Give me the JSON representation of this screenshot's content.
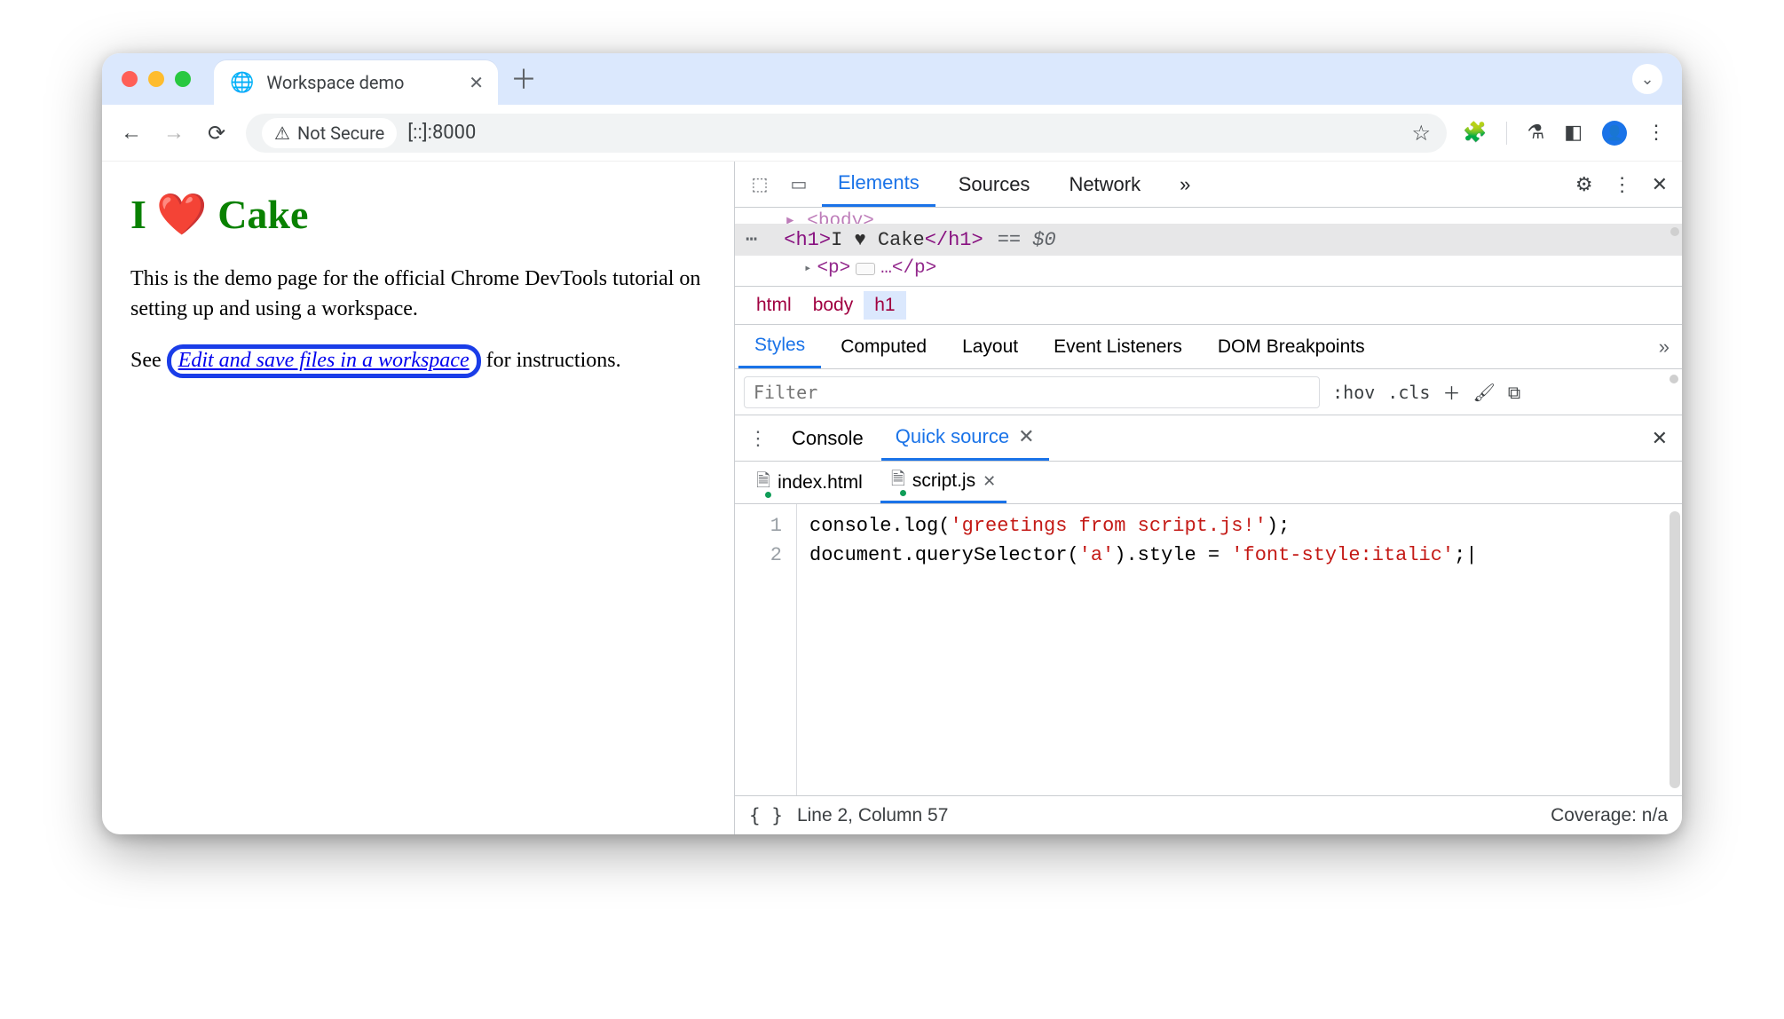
{
  "browser": {
    "tab_title": "Workspace demo",
    "security_label": "Not Secure",
    "url": "[::]:8000"
  },
  "page": {
    "h1_prefix": "I ",
    "h1_heart": "❤️",
    "h1_suffix": " Cake",
    "p1": "This is the demo page for the official Chrome DevTools tutorial on setting up and using a workspace.",
    "p2_prefix": "See ",
    "p2_link": "Edit and save files in a workspace",
    "p2_suffix": " for instructions."
  },
  "devtools": {
    "tabs": {
      "elements": "Elements",
      "sources": "Sources",
      "network": "Network",
      "more": "»"
    },
    "dom": {
      "prev": "<body>",
      "selected_open": "<h1>",
      "selected_text": "I ♥ Cake",
      "selected_close": "</h1>",
      "eq": "== $0",
      "next_open": "<p>",
      "next_rest": "…</p>"
    },
    "crumbs": {
      "c0": "html",
      "c1": "body",
      "c2": "h1"
    },
    "subtabs": {
      "styles": "Styles",
      "computed": "Computed",
      "layout": "Layout",
      "events": "Event Listeners",
      "dom_bp": "DOM Breakpoints",
      "more": "»"
    },
    "filter": {
      "placeholder": "Filter",
      "hov": ":hov",
      "cls": ".cls"
    },
    "drawer": {
      "console": "Console",
      "quick_source": "Quick source"
    },
    "files": {
      "index": "index.html",
      "script": "script.js"
    },
    "code": {
      "l1_a": "console.log(",
      "l1_b": "'greetings from script.js!'",
      "l1_c": ");",
      "l2_a": "document.querySelector(",
      "l2_b": "'a'",
      "l2_c": ").style = ",
      "l2_d": "'font-style:italic'",
      "l2_e": ";"
    },
    "status": {
      "pos": "Line 2, Column 57",
      "coverage": "Coverage: n/a"
    }
  }
}
